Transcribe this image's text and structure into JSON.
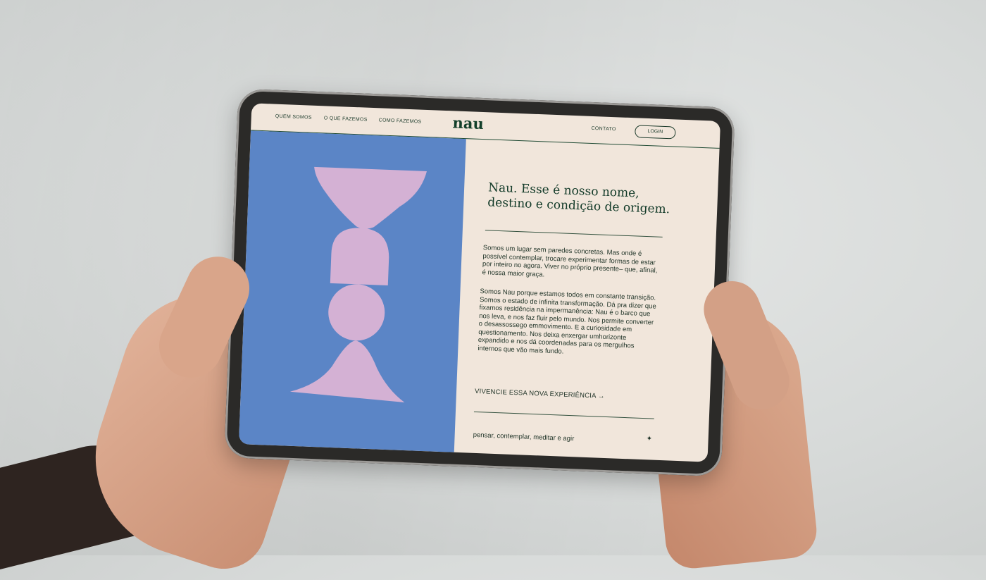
{
  "nav": {
    "links": [
      "QUEM SOMOS",
      "O QUE FAZEMOS",
      "COMO FAZEMOS"
    ],
    "logo": "nau",
    "contact": "CONTATO",
    "login": "LOGIN"
  },
  "hero": {
    "headline_line1": "Nau. Esse é nosso nome,",
    "headline_line2": "destino e condição de origem.",
    "paragraph1": "Somos um lugar sem paredes concretas. Mas onde é possível contemplar, trocare experimentar formas de estar por inteiro no agora. Viver no próprio presente– que, afinal, é nossa maior graça.",
    "paragraph2": "Somos Nau porque estamos todos em constante transição. Somos o estado de infinita transformação. Dá pra dizer que fixamos residência na impermanência: Nau é o barco que nos leva, e nos faz fluir pelo mundo. Nos permite converter o desassossego emmovimento. E a curiosidade em questionamento. Nos deixa enxergar umhorizonte expandido e nos dá coordenadas para os mergulhos internos que vão mais fundo.",
    "cta": "VIVENCIE ESSA NOVA EXPERIÊNCIA →",
    "tagline": "pensar, contemplar, meditar e agir",
    "star_icon": "✦"
  },
  "colors": {
    "blue_panel": "#5b85c6",
    "pink_shapes": "#d4b1d4",
    "dark_green": "#123f2a",
    "cream": "#f1e6db"
  }
}
